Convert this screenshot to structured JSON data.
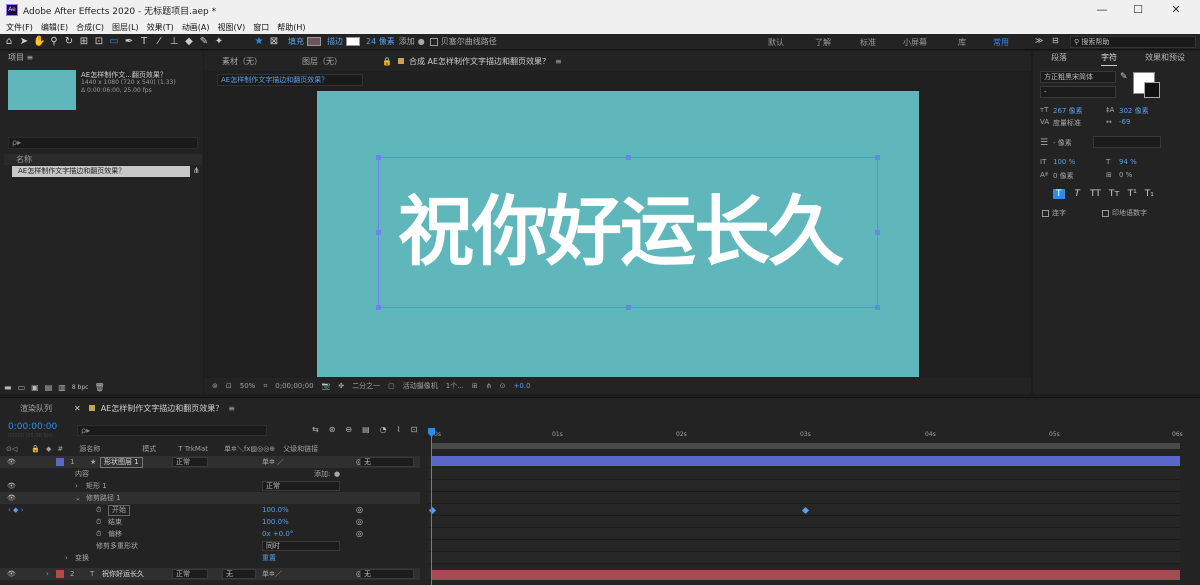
{
  "window": {
    "title": "Adobe After Effects 2020 - 无标题项目.aep *",
    "logo": "Ae",
    "minimize": "—",
    "maximize": "☐",
    "close": "✕"
  },
  "menu": [
    "文件(F)",
    "编辑(E)",
    "合成(C)",
    "图层(L)",
    "效果(T)",
    "动画(A)",
    "视图(V)",
    "窗口",
    "帮助(H)"
  ],
  "toolbar": {
    "fill_label": "填充",
    "stroke_label": "描边",
    "stroke_width": "24 像素",
    "add_label": "添加",
    "bezier_label": "贝塞尔曲线路径",
    "workspaces": [
      "默认",
      "了解",
      "标准",
      "小屏幕",
      "库",
      "常用"
    ],
    "active_workspace": "常用",
    "search_placeholder": "搜索帮助"
  },
  "project": {
    "title": "项目",
    "comp_name": "AE怎样制作文...翻页效果？",
    "comp_info1": "1440 x 1080 (720 x 540) (1.33)",
    "comp_info2": "Δ 0:00:06:00, 25.00 fps",
    "search_placeholder": "ρ▸",
    "col_name": "名称",
    "item_name": "AE怎样制作文字描边和翻页效果？",
    "bpc": "8 bpc"
  },
  "viewer": {
    "tab_footage": "素材（无）",
    "tab_layer": "图层（无）",
    "tab_comp": "合成 AE怎样制作文字描边和翻页效果？",
    "crumb": "AE怎样制作文字描边和翻页效果？",
    "text": "祝你好运长久",
    "zoom": "50%",
    "timecode": "0;00;00;00",
    "resolution": "二分之一",
    "camera": "活动摄像机",
    "views": "1个...",
    "exposure": "+0.0"
  },
  "character": {
    "tabs": [
      "段落",
      "字符",
      "效果和预设"
    ],
    "active_tab": "字符",
    "font": "方正粗黑宋简体",
    "style": "-",
    "font_size": "267 像素",
    "leading": "302 像素",
    "kerning": "度量标准",
    "tracking": "-69",
    "stroke_width": "- 像素",
    "vert_scale": "100 %",
    "horiz_scale": "94 %",
    "baseline": "0 像素",
    "tsume": "0 %",
    "styles": [
      "T",
      "T",
      "TT",
      "Tт",
      "T¹",
      "T₁"
    ],
    "ligature": "连字",
    "hindi": "印地语数字"
  },
  "timeline": {
    "tab_render": "渲染队列",
    "tab_comp": "AE怎样制作文字描边和翻页效果？",
    "timecode": "0:00:00:00",
    "timecode_sub": "00000 (25.00 fps)",
    "search_placeholder": "ρ▸",
    "columns": {
      "num": "#",
      "source": "源名称",
      "mode": "模式",
      "trkmat": "T TrkMat",
      "switches": "单✲＼fx▨◎◎⊕",
      "parent": "父级和链接"
    },
    "ticks": [
      "0s",
      "01s",
      "02s",
      "03s",
      "04s",
      "05s",
      "06s"
    ],
    "layer1": {
      "num": "1",
      "name": "形状图层 1",
      "mode": "正常",
      "parent": "无"
    },
    "contents_label": "内容",
    "add_label": "添加:",
    "shape1_label": "矩形 1",
    "shape1_mode": "正常",
    "trim_label": "修剪路径 1",
    "start_label": "开始",
    "start_value": "100.0%",
    "end_label": "结束",
    "end_value": "100.0%",
    "offset_label": "偏移",
    "offset_value": "0x +0.0°",
    "trim_multi_label": "修剪多重形状",
    "trim_multi_value": "同时",
    "transform_label": "变换",
    "transform_value": "重置",
    "layer2": {
      "num": "2",
      "name": "祝你好运长久",
      "mode": "正常",
      "trkmat": "无",
      "parent": "无"
    }
  }
}
